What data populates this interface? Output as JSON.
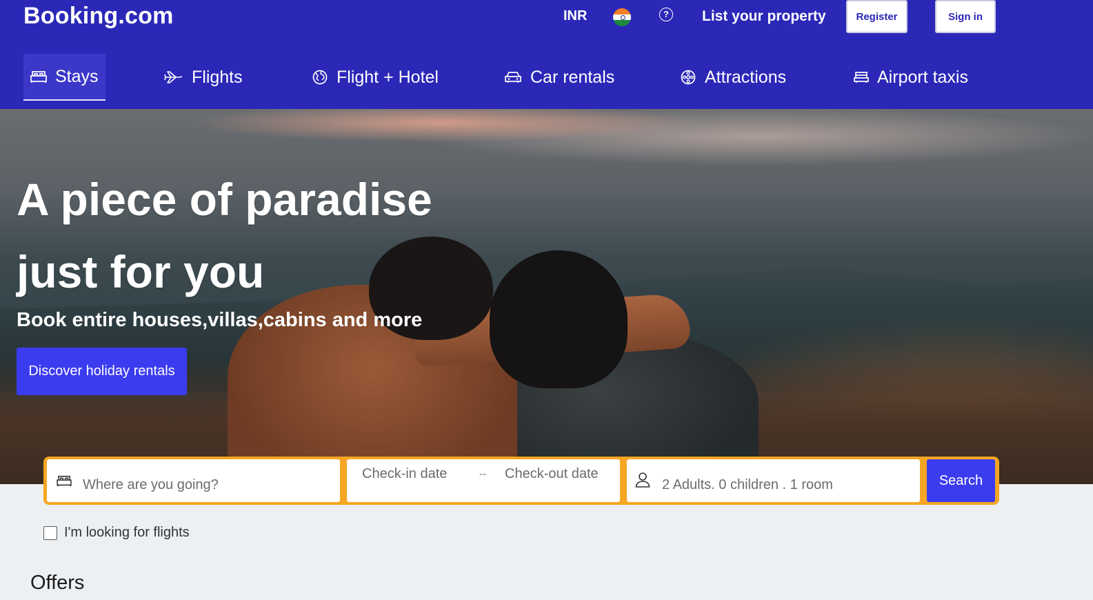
{
  "header": {
    "logo": "Booking.com",
    "currency": "INR",
    "help": "?",
    "list_property": "List your property",
    "register": "Register",
    "sign_in": "Sign in"
  },
  "nav": {
    "items": [
      {
        "label": "Stays",
        "icon": "bed-icon",
        "active": true
      },
      {
        "label": "Flights",
        "icon": "plane-icon",
        "active": false
      },
      {
        "label": "Flight + Hotel",
        "icon": "globe-icon",
        "active": false
      },
      {
        "label": "Car rentals",
        "icon": "car-icon",
        "active": false
      },
      {
        "label": "Attractions",
        "icon": "attraction-icon",
        "active": false
      },
      {
        "label": "Airport taxis",
        "icon": "taxi-icon",
        "active": false
      }
    ]
  },
  "hero": {
    "title_line1": "A piece of paradise",
    "title_line2": "just for you",
    "subtitle": "Book entire houses,villas,cabins and more",
    "cta": "Discover holiday rentals"
  },
  "search": {
    "destination_placeholder": "Where are you going?",
    "checkin": "Check-in date",
    "separator": "--",
    "checkout": "Check-out date",
    "guests": "2 Adults. 0 children . 1 room",
    "button": "Search"
  },
  "flights_checkbox": {
    "label": "I'm looking for flights",
    "checked": false
  },
  "offers": {
    "heading": "Offers"
  },
  "colors": {
    "brand": "#2b28b8",
    "accent": "#3b3bf0",
    "search_border": "#f5a623"
  }
}
